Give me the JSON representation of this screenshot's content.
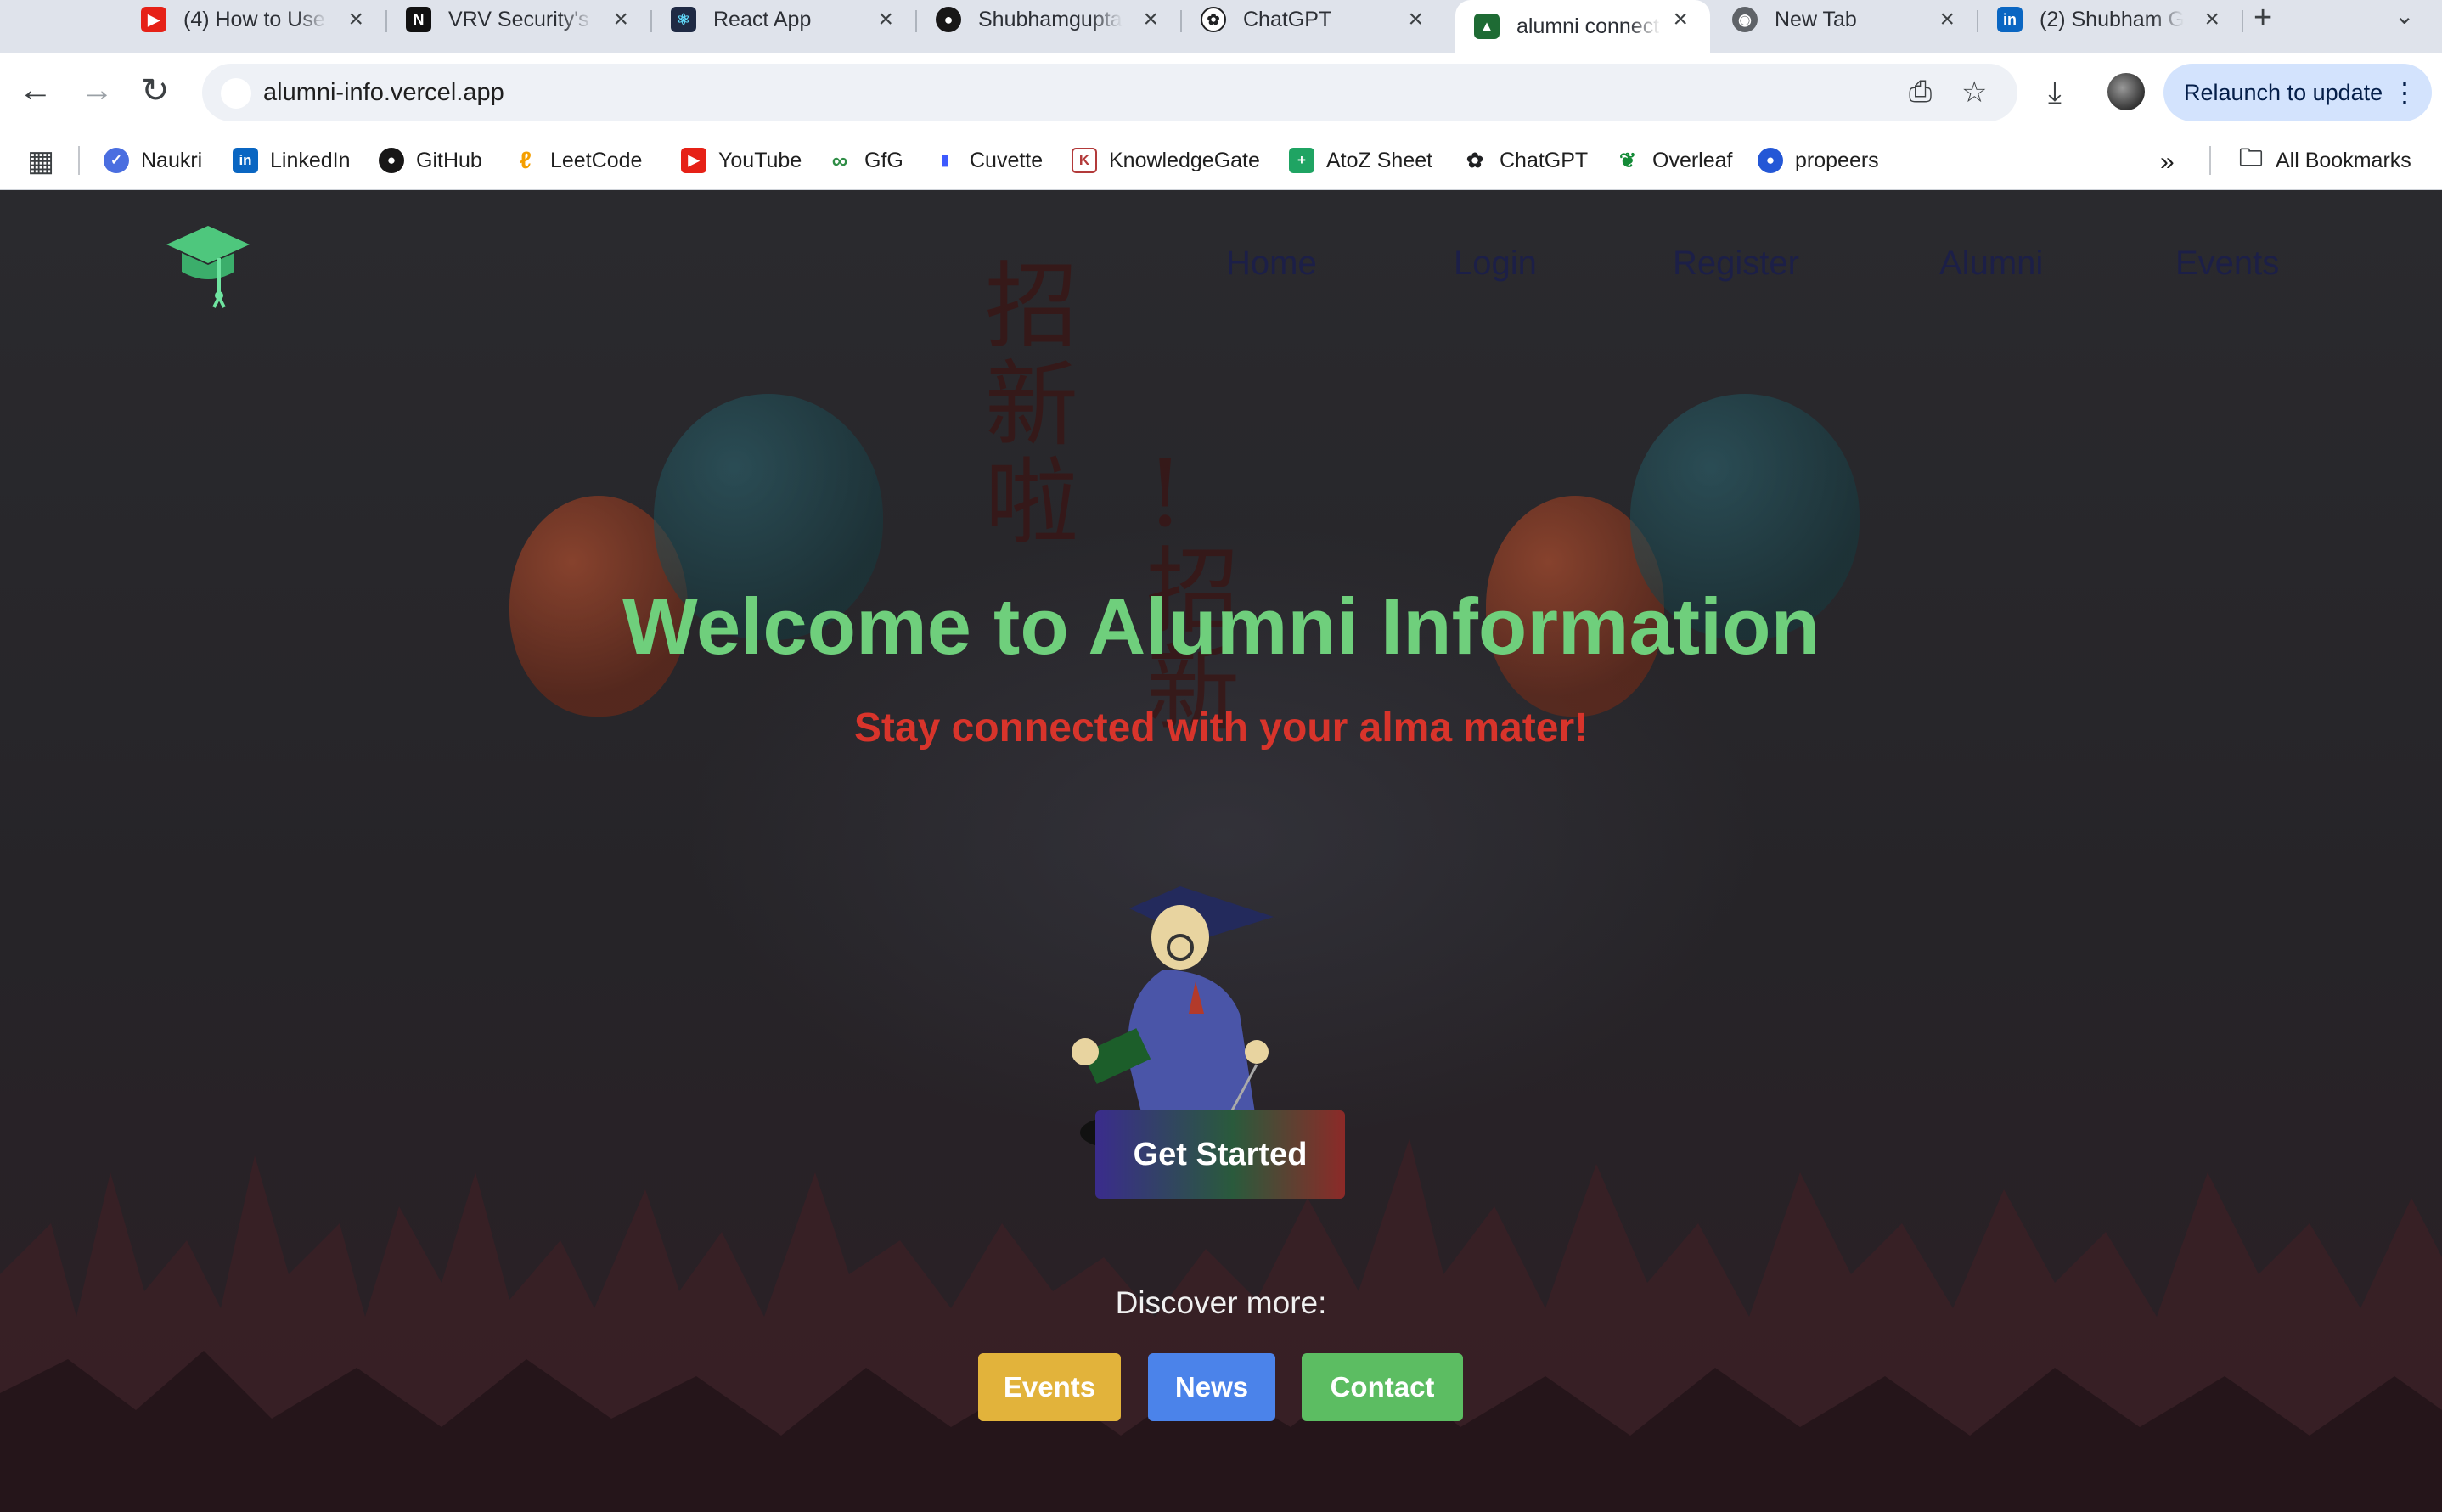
{
  "tabs": [
    {
      "title": "(4) How to Use",
      "icon": "youtube-icon",
      "color": "#e62117",
      "glyph": "▶"
    },
    {
      "title": "VRV Security's",
      "icon": "notion-icon",
      "color": "#111111",
      "glyph": "N"
    },
    {
      "title": "React App",
      "icon": "react-icon",
      "color": "#1f2a44",
      "glyph": "⚛"
    },
    {
      "title": "Shubhamgupta",
      "icon": "github-icon",
      "color": "#181717",
      "glyph": "●"
    },
    {
      "title": "ChatGPT",
      "icon": "chatgpt-icon",
      "color": "#202123",
      "glyph": "✿"
    },
    {
      "title": "alumni connect",
      "icon": "graduation-cap-icon",
      "color": "#1e6b34",
      "glyph": "🎓",
      "active": true
    },
    {
      "title": "New Tab",
      "icon": "chrome-icon",
      "color": "#5f6368",
      "glyph": "◉"
    },
    {
      "title": "(2) Shubham G",
      "icon": "linkedin-icon",
      "color": "#0a66c2",
      "glyph": "in"
    }
  ],
  "address": {
    "url": "alumni-info.vercel.app",
    "relaunch_label": "Relaunch to update"
  },
  "bookmarks": [
    {
      "label": "Naukri",
      "icon": "naukri-icon",
      "color": "#4a6ee0",
      "glyph": "✓"
    },
    {
      "label": "LinkedIn",
      "icon": "linkedin-icon",
      "color": "#0a66c2",
      "glyph": "in"
    },
    {
      "label": "GitHub",
      "icon": "github-icon",
      "color": "#181717",
      "glyph": "●"
    },
    {
      "label": "LeetCode",
      "icon": "leetcode-icon",
      "color": "#f59f00",
      "glyph": "ℓ"
    },
    {
      "label": "YouTube",
      "icon": "youtube-icon",
      "color": "#e62117",
      "glyph": "▶"
    },
    {
      "label": "GfG",
      "icon": "gfg-icon",
      "color": "#2f8d46",
      "glyph": "∞"
    },
    {
      "label": "Cuvette",
      "icon": "cuvette-icon",
      "color": "#3d5afe",
      "glyph": "▮"
    },
    {
      "label": "KnowledgeGate",
      "icon": "knowledgegate-icon",
      "color": "#b33a3a",
      "glyph": "K"
    },
    {
      "label": "AtoZ Sheet",
      "icon": "atoz-sheet-icon",
      "color": "#1fa463",
      "glyph": "+"
    },
    {
      "label": "ChatGPT",
      "icon": "chatgpt-icon",
      "color": "#202123",
      "glyph": "✿"
    },
    {
      "label": "Overleaf",
      "icon": "overleaf-icon",
      "color": "#138a36",
      "glyph": "❦"
    },
    {
      "label": "propeers",
      "icon": "propeers-icon",
      "color": "#2457d6",
      "glyph": "●"
    }
  ],
  "all_bookmarks_label": "All Bookmarks",
  "site": {
    "nav": [
      "Home",
      "Login",
      "Register",
      "Alumni",
      "Events"
    ],
    "hero_title": "Welcome to Alumni Information",
    "hero_subtitle": "Stay connected with your alma mater!",
    "cta_label": "Get Started",
    "discover_label": "Discover more:",
    "links": [
      "Events",
      "News",
      "Contact"
    ],
    "background_chars": [
      "招",
      "新",
      "啦",
      "!",
      "招",
      "新",
      "啦"
    ]
  },
  "colors": {
    "title_green": "#6fcf7c",
    "subtitle_red": "#d8342b",
    "events_yellow": "#e2b33b",
    "news_blue": "#4b83ea",
    "contact_green": "#5cbd62"
  }
}
